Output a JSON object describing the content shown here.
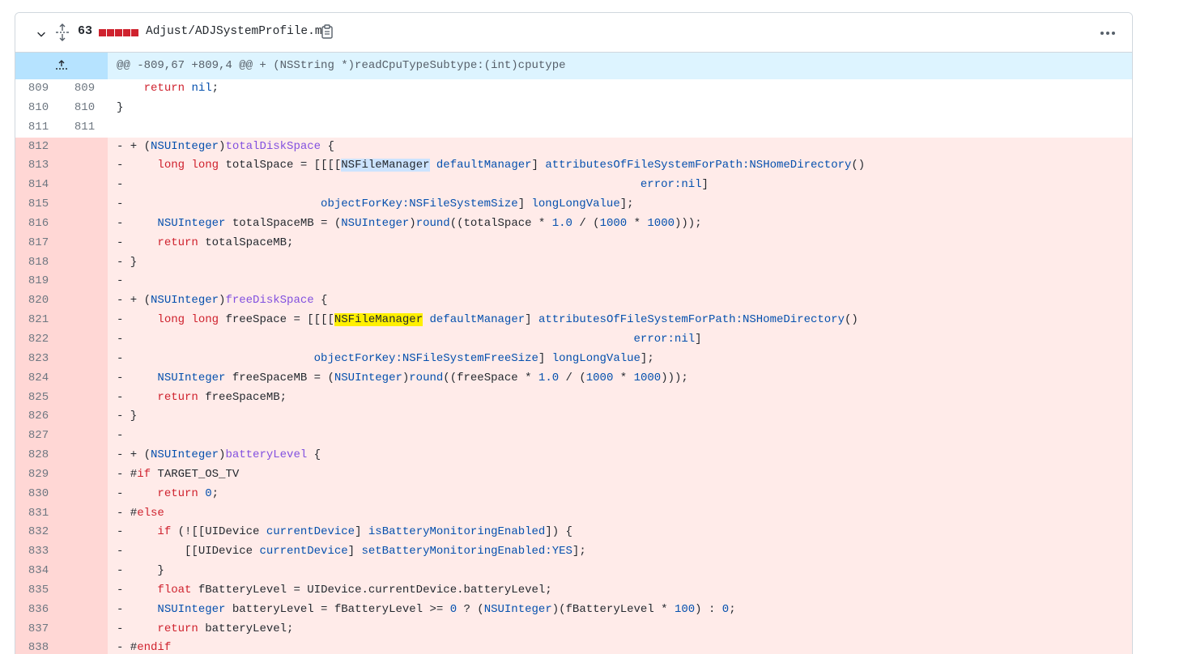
{
  "file": {
    "change_count": "63",
    "name": "Adjust/ADJSystemProfile.m",
    "diff_color": "#cf222e"
  },
  "hunk": {
    "text": "@@ -809,67 +809,4 @@ + (NSString *)readCpuTypeSubtype:(int)cputype"
  },
  "lines": [
    {
      "old": "809",
      "new": "809",
      "type": "ctx",
      "segs": [
        [
          "",
          "    "
        ],
        [
          "kw",
          "return"
        ],
        [
          "",
          " "
        ],
        [
          "ty",
          "nil"
        ],
        [
          "",
          ";"
        ]
      ]
    },
    {
      "old": "810",
      "new": "810",
      "type": "ctx",
      "segs": [
        [
          "",
          "}"
        ]
      ]
    },
    {
      "old": "811",
      "new": "811",
      "type": "ctx",
      "segs": [
        [
          "",
          ""
        ]
      ]
    },
    {
      "old": "812",
      "new": "",
      "type": "del",
      "segs": [
        [
          "",
          "- + ("
        ],
        [
          "ty",
          "NSUInteger"
        ],
        [
          "",
          ")"
        ],
        [
          "fn",
          "totalDiskSpace"
        ],
        [
          "",
          " {"
        ]
      ]
    },
    {
      "old": "813",
      "new": "",
      "type": "del",
      "segs": [
        [
          "",
          "-     "
        ],
        [
          "kw",
          "long"
        ],
        [
          "",
          " "
        ],
        [
          "kw",
          "long"
        ],
        [
          "",
          " totalSpace = [[[["
        ],
        [
          "hl1",
          "NSFileManager"
        ],
        [
          "",
          " "
        ],
        [
          "ty",
          "defaultManager"
        ],
        [
          "",
          "] "
        ],
        [
          "ty",
          "attributesOfFileSystemForPath:NSHomeDirectory"
        ],
        [
          "",
          "()"
        ]
      ]
    },
    {
      "old": "814",
      "new": "",
      "type": "del",
      "segs": [
        [
          "",
          "-                                                                            "
        ],
        [
          "ty",
          "error:nil"
        ],
        [
          "",
          "]"
        ]
      ]
    },
    {
      "old": "815",
      "new": "",
      "type": "del",
      "segs": [
        [
          "",
          "-                             "
        ],
        [
          "ty",
          "objectForKey:NSFileSystemSize"
        ],
        [
          "",
          "] "
        ],
        [
          "ty",
          "longLongValue"
        ],
        [
          "",
          "];"
        ]
      ]
    },
    {
      "old": "816",
      "new": "",
      "type": "del",
      "segs": [
        [
          "",
          "-     "
        ],
        [
          "ty",
          "NSUInteger"
        ],
        [
          "",
          " totalSpaceMB = ("
        ],
        [
          "ty",
          "NSUInteger"
        ],
        [
          "",
          ")"
        ],
        [
          "ty",
          "round"
        ],
        [
          "",
          "((totalSpace * "
        ],
        [
          "nm",
          "1.0"
        ],
        [
          "",
          " / ("
        ],
        [
          "nm",
          "1000"
        ],
        [
          "",
          " * "
        ],
        [
          "nm",
          "1000"
        ],
        [
          "",
          ")));"
        ]
      ]
    },
    {
      "old": "817",
      "new": "",
      "type": "del",
      "segs": [
        [
          "",
          "-     "
        ],
        [
          "kw",
          "return"
        ],
        [
          "",
          " totalSpaceMB;"
        ]
      ]
    },
    {
      "old": "818",
      "new": "",
      "type": "del",
      "segs": [
        [
          "",
          "- }"
        ]
      ]
    },
    {
      "old": "819",
      "new": "",
      "type": "del",
      "segs": [
        [
          "",
          "-"
        ]
      ]
    },
    {
      "old": "820",
      "new": "",
      "type": "del",
      "segs": [
        [
          "",
          "- + ("
        ],
        [
          "ty",
          "NSUInteger"
        ],
        [
          "",
          ")"
        ],
        [
          "fn",
          "freeDiskSpace"
        ],
        [
          "",
          " {"
        ]
      ]
    },
    {
      "old": "821",
      "new": "",
      "type": "del",
      "segs": [
        [
          "",
          "-     "
        ],
        [
          "kw",
          "long"
        ],
        [
          "",
          " "
        ],
        [
          "kw",
          "long"
        ],
        [
          "",
          " freeSpace = [[[["
        ],
        [
          "hl2",
          "NSFileManager"
        ],
        [
          "",
          " "
        ],
        [
          "ty",
          "defaultManager"
        ],
        [
          "",
          "] "
        ],
        [
          "ty",
          "attributesOfFileSystemForPath:NSHomeDirectory"
        ],
        [
          "",
          "()"
        ]
      ]
    },
    {
      "old": "822",
      "new": "",
      "type": "del",
      "segs": [
        [
          "",
          "-                                                                           "
        ],
        [
          "ty",
          "error:nil"
        ],
        [
          "",
          "]"
        ]
      ]
    },
    {
      "old": "823",
      "new": "",
      "type": "del",
      "segs": [
        [
          "",
          "-                            "
        ],
        [
          "ty",
          "objectForKey:NSFileSystemFreeSize"
        ],
        [
          "",
          "] "
        ],
        [
          "ty",
          "longLongValue"
        ],
        [
          "",
          "];"
        ]
      ]
    },
    {
      "old": "824",
      "new": "",
      "type": "del",
      "segs": [
        [
          "",
          "-     "
        ],
        [
          "ty",
          "NSUInteger"
        ],
        [
          "",
          " freeSpaceMB = ("
        ],
        [
          "ty",
          "NSUInteger"
        ],
        [
          "",
          ")"
        ],
        [
          "ty",
          "round"
        ],
        [
          "",
          "((freeSpace * "
        ],
        [
          "nm",
          "1.0"
        ],
        [
          "",
          " / ("
        ],
        [
          "nm",
          "1000"
        ],
        [
          "",
          " * "
        ],
        [
          "nm",
          "1000"
        ],
        [
          "",
          ")));"
        ]
      ]
    },
    {
      "old": "825",
      "new": "",
      "type": "del",
      "segs": [
        [
          "",
          "-     "
        ],
        [
          "kw",
          "return"
        ],
        [
          "",
          " freeSpaceMB;"
        ]
      ]
    },
    {
      "old": "826",
      "new": "",
      "type": "del",
      "segs": [
        [
          "",
          "- }"
        ]
      ]
    },
    {
      "old": "827",
      "new": "",
      "type": "del",
      "segs": [
        [
          "",
          "-"
        ]
      ]
    },
    {
      "old": "828",
      "new": "",
      "type": "del",
      "segs": [
        [
          "",
          "- + ("
        ],
        [
          "ty",
          "NSUInteger"
        ],
        [
          "",
          ")"
        ],
        [
          "fn",
          "batteryLevel"
        ],
        [
          "",
          " {"
        ]
      ]
    },
    {
      "old": "829",
      "new": "",
      "type": "del",
      "segs": [
        [
          "",
          "- #"
        ],
        [
          "kw",
          "if"
        ],
        [
          "",
          " TARGET_OS_TV"
        ]
      ]
    },
    {
      "old": "830",
      "new": "",
      "type": "del",
      "segs": [
        [
          "",
          "-     "
        ],
        [
          "kw",
          "return"
        ],
        [
          "",
          " "
        ],
        [
          "nm",
          "0"
        ],
        [
          "",
          ";"
        ]
      ]
    },
    {
      "old": "831",
      "new": "",
      "type": "del",
      "segs": [
        [
          "",
          "- #"
        ],
        [
          "kw",
          "else"
        ]
      ]
    },
    {
      "old": "832",
      "new": "",
      "type": "del",
      "segs": [
        [
          "",
          "-     "
        ],
        [
          "kw",
          "if"
        ],
        [
          "",
          " (![[UIDevice "
        ],
        [
          "ty",
          "currentDevice"
        ],
        [
          "",
          "] "
        ],
        [
          "ty",
          "isBatteryMonitoringEnabled"
        ],
        [
          "",
          "]) {"
        ]
      ]
    },
    {
      "old": "833",
      "new": "",
      "type": "del",
      "segs": [
        [
          "",
          "-         [[UIDevice "
        ],
        [
          "ty",
          "currentDevice"
        ],
        [
          "",
          "] "
        ],
        [
          "ty",
          "setBatteryMonitoringEnabled:YES"
        ],
        [
          "",
          "];"
        ]
      ]
    },
    {
      "old": "834",
      "new": "",
      "type": "del",
      "segs": [
        [
          "",
          "-     }"
        ]
      ]
    },
    {
      "old": "835",
      "new": "",
      "type": "del",
      "segs": [
        [
          "",
          "-     "
        ],
        [
          "kw",
          "float"
        ],
        [
          "",
          " fBatteryLevel = UIDevice.currentDevice.batteryLevel;"
        ]
      ]
    },
    {
      "old": "836",
      "new": "",
      "type": "del",
      "segs": [
        [
          "",
          "-     "
        ],
        [
          "ty",
          "NSUInteger"
        ],
        [
          "",
          " batteryLevel = fBatteryLevel >= "
        ],
        [
          "nm",
          "0"
        ],
        [
          "",
          " ? ("
        ],
        [
          "ty",
          "NSUInteger"
        ],
        [
          "",
          ")(fBatteryLevel * "
        ],
        [
          "nm",
          "100"
        ],
        [
          "",
          ") : "
        ],
        [
          "nm",
          "0"
        ],
        [
          "",
          ";"
        ]
      ]
    },
    {
      "old": "837",
      "new": "",
      "type": "del",
      "segs": [
        [
          "",
          "-     "
        ],
        [
          "kw",
          "return"
        ],
        [
          "",
          " batteryLevel;"
        ]
      ]
    },
    {
      "old": "838",
      "new": "",
      "type": "del",
      "segs": [
        [
          "",
          "- #"
        ],
        [
          "kw",
          "endif"
        ]
      ]
    }
  ]
}
